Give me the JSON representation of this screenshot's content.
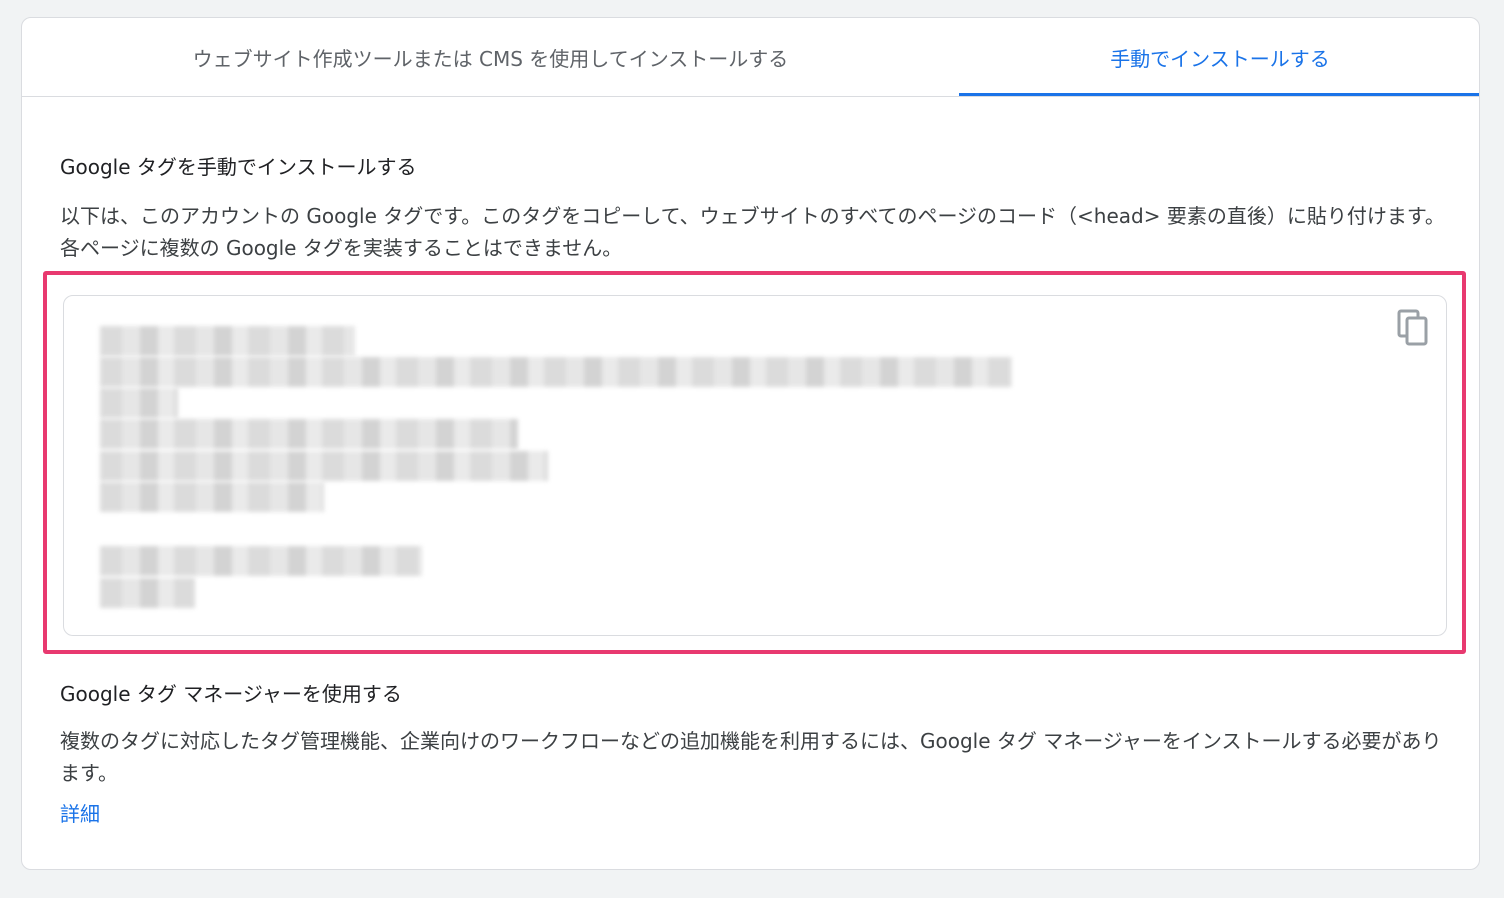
{
  "tabs": [
    {
      "label": "ウェブサイト作成ツールまたは CMS を使用してインストールする",
      "active": false
    },
    {
      "label": "手動でインストールする",
      "active": true
    }
  ],
  "manual_install": {
    "title": "Google タグを手動でインストールする",
    "description": "以下は、このアカウントの Google タグです。このタグをコピーして、ウェブサイトのすべてのページのコード（<head> 要素の直後）に貼り付けます。各ページに複数の Google タグを実装することはできません。",
    "code_snippet_state": "blurred",
    "copy_icon": "copy-icon"
  },
  "tag_manager": {
    "title": "Google タグ マネージャーを使用する",
    "description": "複数のタグに対応したタグ管理機能、企業向けのワークフローなどの追加機能を利用するには、Google タグ マネージャーをインストールする必要があります。",
    "learn_more_label": "詳細"
  },
  "colors": {
    "accent": "#1a73e8",
    "highlight_border": "#e8396f",
    "page_background": "#f1f3f4"
  }
}
